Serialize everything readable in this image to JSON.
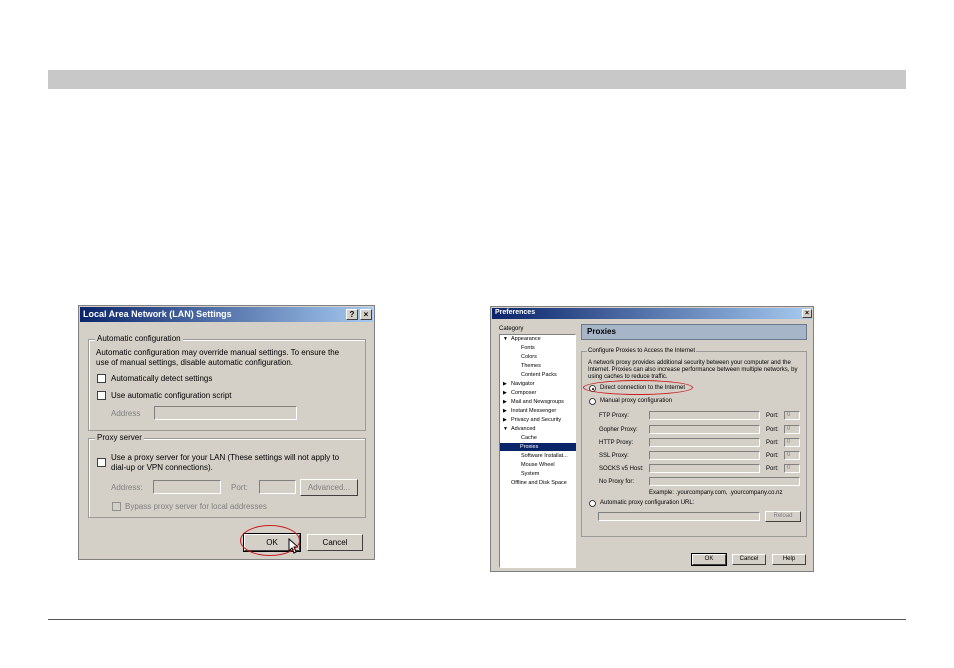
{
  "lan_dialog": {
    "title": "Local Area Network (LAN) Settings",
    "help_btn": "?",
    "close_btn": "×",
    "auto_config": {
      "legend": "Automatic configuration",
      "desc1": "Automatic configuration may override manual settings.  To ensure the",
      "desc2": "use of manual settings, disable automatic configuration.",
      "detect": "Automatically detect settings",
      "script": "Use automatic configuration script",
      "address_label": "Address"
    },
    "proxy": {
      "legend": "Proxy server",
      "use1": "Use a proxy server for your LAN (These settings will not apply to",
      "use2": "dial-up or VPN connections).",
      "address_label": "Address:",
      "port_label": "Port:",
      "advanced": "Advanced...",
      "bypass": "Bypass proxy server for local addresses"
    },
    "ok": "OK",
    "cancel": "Cancel"
  },
  "prefs_dialog": {
    "title": "Preferences",
    "close_btn": "×",
    "category_label": "Category",
    "tree": [
      {
        "label": "Appearance",
        "expand": "▼"
      },
      {
        "label": "Fonts"
      },
      {
        "label": "Colors"
      },
      {
        "label": "Themes"
      },
      {
        "label": "Content Packs"
      },
      {
        "label": "Navigator",
        "expand": "▶"
      },
      {
        "label": "Composer",
        "expand": "▶"
      },
      {
        "label": "Mail and Newsgroups",
        "expand": "▶"
      },
      {
        "label": "Instant Messenger",
        "expand": "▶"
      },
      {
        "label": "Privacy and Security",
        "expand": "▶"
      },
      {
        "label": "Advanced",
        "expand": "▼"
      },
      {
        "label": "Cache"
      },
      {
        "label": "Proxies"
      },
      {
        "label": "Software Installat..."
      },
      {
        "label": "Mouse Wheel"
      },
      {
        "label": "System"
      },
      {
        "label": "Offline and Disk Space"
      }
    ],
    "panel_title": "Proxies",
    "group_legend": "Configure Proxies to Access the Internet",
    "desc1": "A network proxy provides additional security between your computer and the",
    "desc2": "Internet. Proxies can also increase performance between multiple networks, by",
    "desc3": "using caches to reduce traffic.",
    "direct": "Direct connection to the Internet",
    "manual": "Manual proxy configuration",
    "ftp": "FTP Proxy:",
    "gopher": "Gopher Proxy:",
    "http": "HTTP Proxy:",
    "ssl": "SSL Proxy:",
    "socks": "SOCKS v5 Host:",
    "port_label": "Port:",
    "port_value": "0",
    "noproxy": "No Proxy for:",
    "example": "Example: .yourcompany.com, .yourcompany.co.nz",
    "auto_url": "Automatic proxy configuration URL:",
    "reload": "Reload",
    "ok": "OK",
    "cancel": "Cancel",
    "help": "Help"
  }
}
